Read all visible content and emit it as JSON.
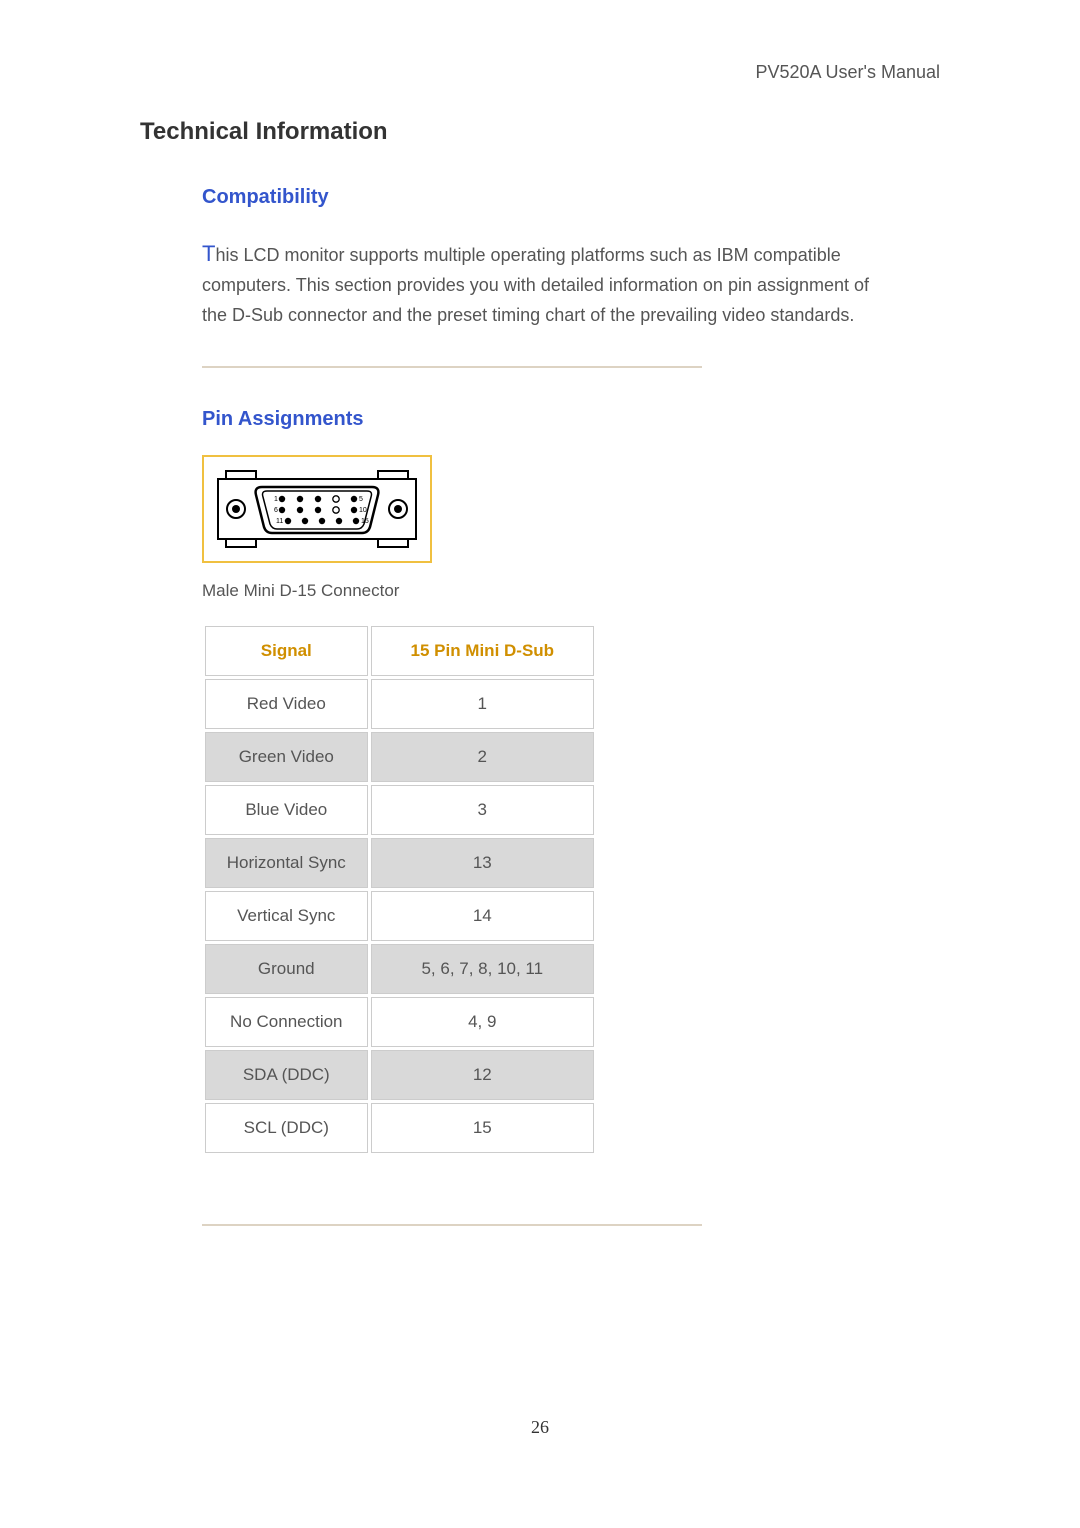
{
  "header": {
    "right_text": "PV520A User's Manual"
  },
  "title": "Technical Information",
  "compatibility": {
    "heading": "Compatibility",
    "dropcap": "T",
    "body_rest": "his LCD monitor supports multiple operating platforms such as IBM compatible computers. This section provides you with detailed information on pin assignment of the D-Sub connector and the preset timing chart of the prevailing video standards."
  },
  "pin_assignments": {
    "heading": "Pin Assignments",
    "caption": "Male Mini D-15 Connector",
    "connector_labels": {
      "p1": "1",
      "p5": "5",
      "p6": "6",
      "p10": "10",
      "p11": "11",
      "p15": "15"
    },
    "table": {
      "headers": {
        "signal": "Signal",
        "pin": "15 Pin Mini D-Sub"
      },
      "rows": [
        {
          "signal": "Red Video",
          "pin": "1",
          "shade": false
        },
        {
          "signal": "Green Video",
          "pin": "2",
          "shade": true
        },
        {
          "signal": "Blue Video",
          "pin": "3",
          "shade": false
        },
        {
          "signal": "Horizontal Sync",
          "pin": "13",
          "shade": true
        },
        {
          "signal": "Vertical Sync",
          "pin": "14",
          "shade": false
        },
        {
          "signal": "Ground",
          "pin": "5, 6, 7, 8, 10, 11",
          "shade": true
        },
        {
          "signal": "No Connection",
          "pin": "4, 9",
          "shade": false
        },
        {
          "signal": "SDA (DDC)",
          "pin": "12",
          "shade": true
        },
        {
          "signal": "SCL (DDC)",
          "pin": "15",
          "shade": false
        }
      ]
    }
  },
  "page_number": "26"
}
